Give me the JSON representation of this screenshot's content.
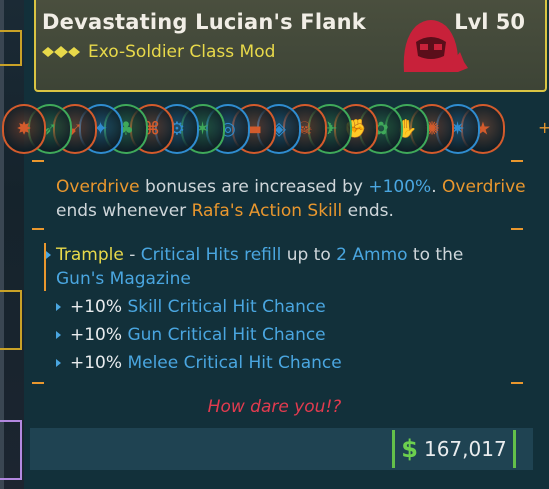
{
  "item": {
    "name": "Devastating Lucian's Flank",
    "level": "Lvl 50",
    "class_mod": "Exo-Soldier Class Mod",
    "colors": {
      "header_border": "#d9c443",
      "subtitle": "#e8d94a",
      "emblem": "#c8213a"
    }
  },
  "skills": [
    {
      "icon": "skull-burst-icon",
      "color": "#d35b2c"
    },
    {
      "icon": "wing-icon",
      "color": "#3fa95a"
    },
    {
      "icon": "blade-rush-icon",
      "color": "#d35b2c"
    },
    {
      "icon": "chevron-tech-icon",
      "color": "#2f8ccf"
    },
    {
      "icon": "flame-sprout-icon",
      "color": "#3fa95a"
    },
    {
      "icon": "tech-ammo-icon",
      "color": "#d35b2c"
    },
    {
      "icon": "circuit-icon",
      "color": "#2f8ccf"
    },
    {
      "icon": "claw-icon",
      "color": "#3fa95a"
    },
    {
      "icon": "orbit-icon",
      "color": "#2f8ccf"
    },
    {
      "icon": "pistol-icon",
      "color": "#d35b2c"
    },
    {
      "icon": "core-icon",
      "color": "#2f8ccf"
    },
    {
      "icon": "target-skull-icon",
      "color": "#d35b2c"
    },
    {
      "icon": "drone-icon",
      "color": "#3fa95a"
    },
    {
      "icon": "gauntlet-icon",
      "color": "#d35b2c"
    },
    {
      "icon": "grenade-icon",
      "color": "#3fa95a"
    },
    {
      "icon": "fist-icon",
      "color": "#3fa95a"
    },
    {
      "icon": "burst-icon",
      "color": "#d35b2c"
    },
    {
      "icon": "spike-icon",
      "color": "#2f8ccf"
    },
    {
      "icon": "star-badge-icon",
      "color": "#d35b2c"
    }
  ],
  "description": {
    "p1": "Overdrive",
    "p2": " bonuses are increased by ",
    "p3": "+100%",
    "p4": ". ",
    "p5": "Overdrive",
    "p6": " ends whenever ",
    "p7": "Rafa's",
    "p8": " ",
    "p9": "Action Skill",
    "p10": " ends."
  },
  "perks": {
    "trample_name": "Trample",
    "trample_dash": " - ",
    "trample_text_1": "Critical Hits refill",
    "trample_text_2": " up to ",
    "trample_text_3": "2 Ammo",
    "trample_text_4": " to the ",
    "trample_text_5": "Gun's Magazine",
    "stats": [
      {
        "value": "+10%",
        "label": "Skill Critical Hit Chance"
      },
      {
        "value": "+10%",
        "label": "Gun Critical Hit Chance"
      },
      {
        "value": "+10%",
        "label": "Melee Critical Hit Chance"
      }
    ]
  },
  "flavor_text": "How dare you!?",
  "price": {
    "symbol": "$",
    "amount": "167,017"
  }
}
